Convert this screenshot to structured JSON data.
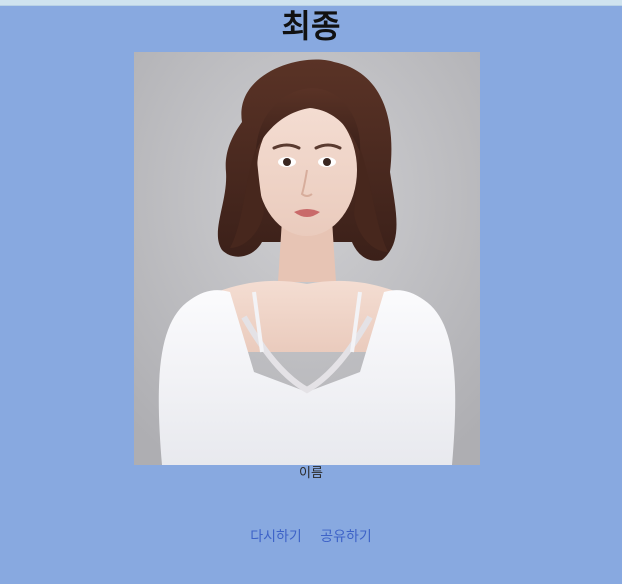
{
  "header": {
    "title": "최종"
  },
  "result": {
    "photo_label": "profile-photo",
    "name": "이름"
  },
  "actions": {
    "retry_label": "다시하기",
    "share_label": "공유하기"
  },
  "colors": {
    "background": "#88a9e0",
    "link": "#3e63c8",
    "photo_backdrop": "#bfbfc2"
  }
}
